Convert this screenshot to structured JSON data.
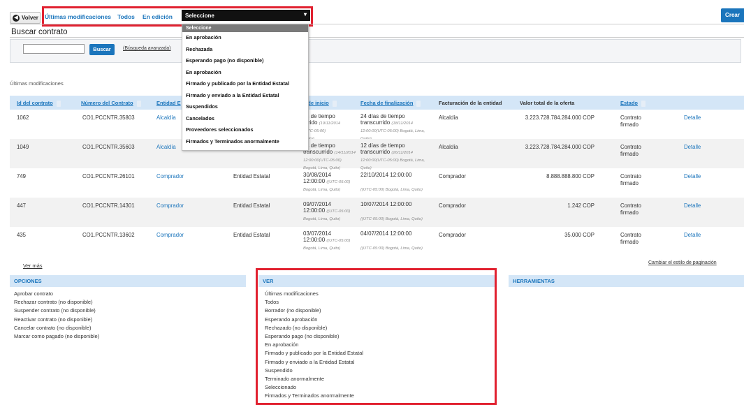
{
  "toolbar": {
    "back_label": "Volver",
    "tabs": [
      "Últimas modificaciones",
      "Todos",
      "En edición"
    ],
    "filter_select_value": "Seleccione",
    "create_label": "Crear"
  },
  "page_title": "Buscar contrato",
  "search": {
    "button_label": "Buscar",
    "advanced_link": "(Búsqueda avanzada)"
  },
  "section_label": "Últimas modificaciones",
  "table": {
    "headers": [
      "Id del contrato",
      "Número del Contrato",
      "Entidad E",
      "s de inicio",
      "Fecha de finalización",
      "Facturación de la entidad",
      "Valor total de la oferta",
      "Estado"
    ],
    "rows": [
      {
        "id": "1062",
        "numero": "CO1.PCCNTR.35803",
        "entidad": "Alcaldía",
        "tipo": "",
        "inicio_1": "as de tiempo",
        "inicio_2": "urrido",
        "inicio_2_tz": "(19/11/2014",
        "inicio_3": "(UTC-05:00)",
        "inicio_4": "Quito)",
        "fin_1": "24 días de tiempo",
        "fin_2": "transcurrido",
        "fin_2_tz": "(18/11/2014",
        "fin_3": "12:00:00(UTC-05:00) Bogotá, Lima,",
        "fin_4": "Quito)",
        "facturacion": "Alcaldía",
        "valor": "3.223.728.784.284.000 COP",
        "estado_1": "Contrato",
        "estado_2": "firmado",
        "detalle": "Detalle"
      },
      {
        "id": "1049",
        "numero": "CO1.PCCNTR.35603",
        "entidad": "Alcaldía",
        "tipo": "",
        "inicio_1": "as de tiempo",
        "inicio_2": "transcurrido",
        "inicio_2_tz": "(14/11/2014",
        "inicio_3": "12:00:00(UTC-05:00)",
        "inicio_4": "Bogotá, Lima, Quito)",
        "fin_1": "12 días de tiempo",
        "fin_2": "transcurrido",
        "fin_2_tz": "(26/11/2014",
        "fin_3": "12:00:00(UTC-05:00) Bogotá, Lima,",
        "fin_4": "Quito)",
        "facturacion": "Alcaldía",
        "valor": "3.223.728.784.284.000 COP",
        "estado_1": "Contrato",
        "estado_2": "firmado",
        "detalle": "Detalle"
      },
      {
        "id": "749",
        "numero": "CO1.PCCNTR.26101",
        "entidad": "Comprador",
        "tipo": "Entidad Estatal",
        "inicio_1": "30/08/2014",
        "inicio_2": "12:00:00",
        "inicio_2_tz": "((UTC-05:00)",
        "inicio_3": "Bogotá, Lima, Quito)",
        "inicio_4": "",
        "fin_1": "22/10/2014 12:00:00",
        "fin_2": "",
        "fin_2_tz": "",
        "fin_3": "((UTC-05:00) Bogotá, Lima, Quito)",
        "fin_4": "",
        "facturacion": "Comprador",
        "valor": "8.888.888.800 COP",
        "estado_1": "Contrato",
        "estado_2": "firmado",
        "detalle": "Detalle"
      },
      {
        "id": "447",
        "numero": "CO1.PCCNTR.14301",
        "entidad": "Comprador",
        "tipo": "Entidad Estatal",
        "inicio_1": "09/07/2014",
        "inicio_2": "12:00:00",
        "inicio_2_tz": "((UTC-05:00)",
        "inicio_3": "Bogotá, Lima, Quito)",
        "inicio_4": "",
        "fin_1": "10/07/2014 12:00:00",
        "fin_2": "",
        "fin_2_tz": "",
        "fin_3": "((UTC-05:00) Bogotá, Lima, Quito)",
        "fin_4": "",
        "facturacion": "Comprador",
        "valor": "1.242 COP",
        "estado_1": "Contrato",
        "estado_2": "firmado",
        "detalle": "Detalle"
      },
      {
        "id": "435",
        "numero": "CO1.PCCNTR.13602",
        "entidad": "Comprador",
        "tipo": "Entidad Estatal",
        "inicio_1": "03/07/2014",
        "inicio_2": "12:00:00",
        "inicio_2_tz": "((UTC-05:00)",
        "inicio_3": "Bogotá, Lima, Quito)",
        "inicio_4": "",
        "fin_1": "04/07/2014 12:00:00",
        "fin_2": "",
        "fin_2_tz": "",
        "fin_3": "((UTC-05:00) Bogotá, Lima, Quito)",
        "fin_4": "",
        "facturacion": "Comprador",
        "valor": "35.000 COP",
        "estado_1": "Contrato",
        "estado_2": "firmado",
        "detalle": "Detalle"
      }
    ]
  },
  "ver_mas": "Ver más",
  "pagination_link": "Cambiar el estilo de paginación",
  "panels": {
    "opciones": {
      "title": "OPCIONES",
      "items": [
        "Aprobar contrato",
        "Rechazar contrato (no disponible)",
        "Suspender contrato (no disponible)",
        "Reactivar contrato (no disponible)",
        "Cancelar contrato (no disponible)",
        "Marcar como pagado (no disponible)"
      ]
    },
    "ver": {
      "title": "VER",
      "items": [
        "Últimas modificaciones",
        "Todos",
        "Borrador (no disponible)",
        "Esperando aprobación",
        "Rechazado (no disponible)",
        "Esperando pago (no disponible)",
        "En aprobación",
        "Firmado y publicado por la Entidad Estatal",
        "Firmado y enviado a la Entidad Estatal",
        "Suspendido",
        "Terminado anormalmente",
        "Seleccionado",
        "Firmados y Terminados anormalmente"
      ]
    },
    "herramientas": {
      "title": "HERRAMIENTAS"
    }
  },
  "dropdown": {
    "options": [
      "Seleccione",
      "En aprobación",
      "Rechazada",
      "Esperando pago (no disponible)",
      "En aprobación",
      "Firmado y publicado por la Entidad Estatal",
      "Firmado y enviado a la Entidad Estatal",
      "Suspendidos",
      "Cancelados",
      "Proveedores seleccionados",
      "Firmados y Terminados anormalmente"
    ]
  },
  "colors": {
    "accent": "#1b75bc",
    "highlight_border": "#e12130",
    "header_bg": "#d4e6f7"
  }
}
